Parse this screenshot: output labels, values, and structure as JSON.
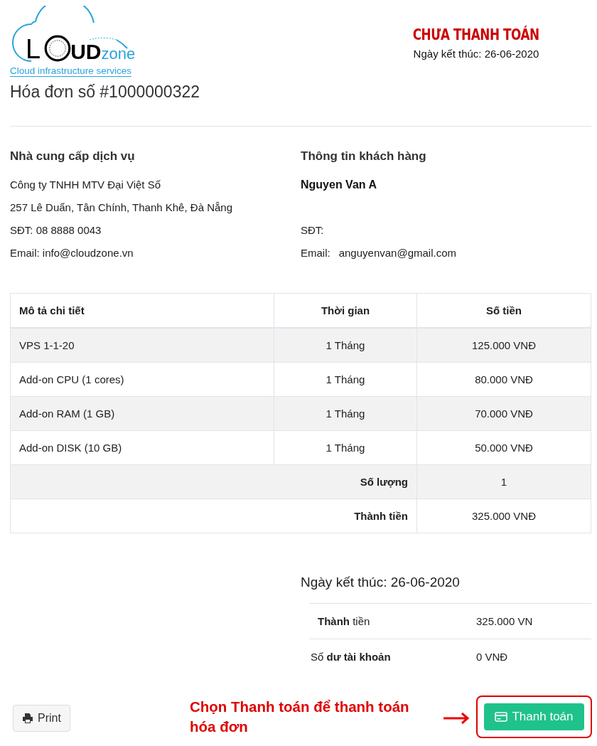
{
  "logo": {
    "letter": "L",
    "bold_part": "UD",
    "suffix": "zone",
    "tagline": "Cloud infrastructure services"
  },
  "status": {
    "label": "CHƯA THANH TOÁN",
    "due_date": "Ngày kết thúc: 26-06-2020"
  },
  "invoice_title": "Hóa đơn số #1000000322",
  "provider": {
    "heading": "Nhà cung cấp dịch vụ",
    "lines": [
      "Công ty TNHH MTV Đại Việt Số",
      "257 Lê Duẩn, Tân Chính, Thanh Khê, Đà Nẵng",
      "SĐT: 08 8888 0043",
      "Email: info@cloudzone.vn"
    ]
  },
  "customer": {
    "heading": "Thông tin khách hàng",
    "name": "Nguyen Van A",
    "phone_label": "SĐT:",
    "email_label": "Email:",
    "email": "anguyenvan@gmail.com"
  },
  "table": {
    "columns": [
      "Mô tả chi tiết",
      "Thời gian",
      "Số tiền"
    ],
    "rows": [
      {
        "description": "VPS 1-1-20",
        "period": "1 Tháng",
        "amount": "125.000 VNĐ"
      },
      {
        "description": "Add-on CPU (1 cores)",
        "period": "1 Tháng",
        "amount": "80.000 VNĐ"
      },
      {
        "description": "Add-on RAM (1 GB)",
        "period": "1 Tháng",
        "amount": "70.000 VNĐ"
      },
      {
        "description": "Add-on DISK (10 GB)",
        "period": "1 Tháng",
        "amount": "50.000 VNĐ"
      }
    ],
    "totals": [
      {
        "label": "Số lượng",
        "value": "1"
      },
      {
        "label": "Thành tiền",
        "value": "325.000 VNĐ"
      }
    ]
  },
  "summary": {
    "due_date": "Ngày kết thúc: 26-06-2020",
    "rows": [
      {
        "label": "**Thành** tiền",
        "value": "325.000 VN"
      },
      {
        "label": "Số **dư tài khoản**",
        "value": "0 VNĐ"
      }
    ]
  },
  "print_button": "Print",
  "annotation": "Chọn Thanh toán để thanh toán hóa đơn",
  "pay_button": "Thanh toán"
}
